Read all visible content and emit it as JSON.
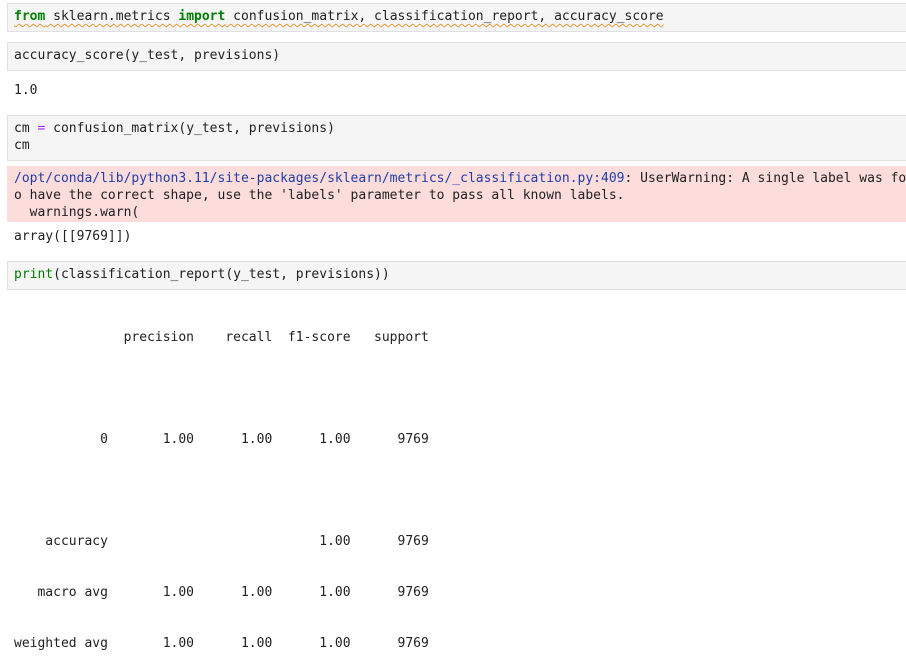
{
  "cells": {
    "import_cell": {
      "kw_from": "from",
      "module": " sklearn.metrics ",
      "kw_import": "import",
      "names": " confusion_matrix, classification_report, accuracy_score"
    },
    "accuracy_cell": {
      "code": "accuracy_score(y_test, previsions)",
      "output": "1.0"
    },
    "cm_cell": {
      "line1_prefix": "cm ",
      "line1_op": "=",
      "line1_rest": " confusion_matrix(y_test, previsions)",
      "line2": "cm",
      "warning_path": "/opt/conda/lib/python3.11/site-packages/sklearn/metrics/_classification.py:409",
      "warning_rest": ": UserWarning: A single label was fo",
      "warning_line2": "o have the correct shape, use the 'labels' parameter to pass all known labels.",
      "warning_line3": "  warnings.warn(",
      "output": "array([[9769]])"
    },
    "report_cell": {
      "builtin": "print",
      "code_rest": "(classification_report(y_test, previsions))",
      "report_lines": [
        "              precision    recall  f1-score   support",
        "",
        "           0       1.00      1.00      1.00      9769",
        "",
        "    accuracy                           1.00      9769",
        "   macro avg       1.00      1.00      1.00      9769",
        "weighted avg       1.00      1.00      1.00      9769"
      ]
    }
  },
  "colors": {
    "keyword": "#008000",
    "operator": "#aa22ff",
    "warning_bg": "#fddcdc",
    "warning_path": "#1f3ea8",
    "cell_bg": "#f5f5f5"
  }
}
